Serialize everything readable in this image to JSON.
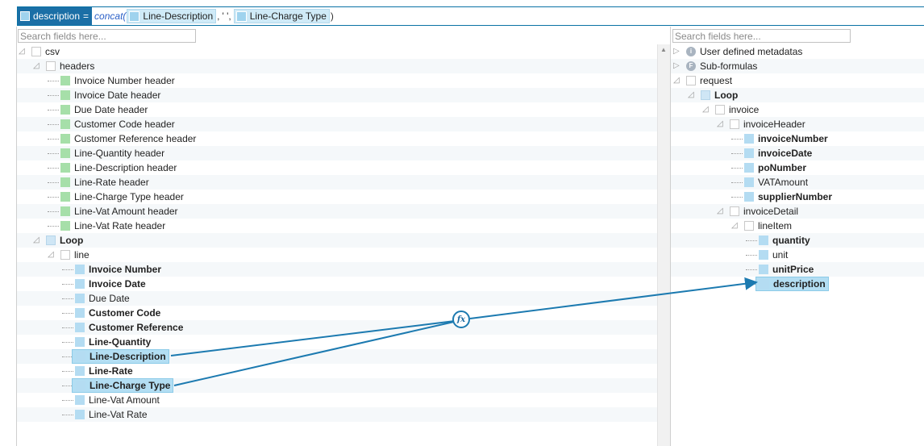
{
  "formula": {
    "target": "description",
    "equals": "=",
    "function": "concat(",
    "arg1": "Line-Description",
    "sep1": ",",
    "arg2_literal": "' '",
    "sep2": ",",
    "arg3": "Line-Charge Type",
    "close": ")"
  },
  "left": {
    "search_placeholder": "Search fields here...",
    "rows": [
      {
        "label": "csv",
        "level": 0,
        "icon": "folder",
        "toggle": "expanded"
      },
      {
        "label": "headers",
        "level": 1,
        "icon": "folder",
        "toggle": "expanded"
      },
      {
        "label": "Invoice Number header",
        "level": 2,
        "icon": "green"
      },
      {
        "label": "Invoice Date header",
        "level": 2,
        "icon": "green"
      },
      {
        "label": "Due Date header",
        "level": 2,
        "icon": "green"
      },
      {
        "label": "Customer Code header",
        "level": 2,
        "icon": "green"
      },
      {
        "label": "Customer Reference header",
        "level": 2,
        "icon": "green"
      },
      {
        "label": "Line-Quantity header",
        "level": 2,
        "icon": "green"
      },
      {
        "label": "Line-Description header",
        "level": 2,
        "icon": "green"
      },
      {
        "label": "Line-Rate header",
        "level": 2,
        "icon": "green"
      },
      {
        "label": "Line-Charge Type header",
        "level": 2,
        "icon": "green"
      },
      {
        "label": "Line-Vat Amount header",
        "level": 2,
        "icon": "green"
      },
      {
        "label": "Line-Vat Rate header",
        "level": 2,
        "icon": "green"
      },
      {
        "label": "Loop",
        "level": 1,
        "icon": "loop",
        "toggle": "expanded",
        "bold": true
      },
      {
        "label": "line",
        "level": 2,
        "icon": "folder",
        "toggle": "expanded"
      },
      {
        "label": "Invoice Number",
        "level": 3,
        "icon": "blue",
        "bold": true
      },
      {
        "label": "Invoice Date",
        "level": 3,
        "icon": "blue",
        "bold": true
      },
      {
        "label": "Due Date",
        "level": 3,
        "icon": "blue"
      },
      {
        "label": "Customer Code",
        "level": 3,
        "icon": "blue",
        "bold": true
      },
      {
        "label": "Customer Reference",
        "level": 3,
        "icon": "blue",
        "bold": true
      },
      {
        "label": "Line-Quantity",
        "level": 3,
        "icon": "blue",
        "bold": true
      },
      {
        "label": "Line-Description",
        "level": 3,
        "icon": "blue",
        "bold": true,
        "selected": true
      },
      {
        "label": "Line-Rate",
        "level": 3,
        "icon": "blue",
        "bold": true
      },
      {
        "label": "Line-Charge Type",
        "level": 3,
        "icon": "blue",
        "bold": true,
        "selected": true
      },
      {
        "label": "Line-Vat Amount",
        "level": 3,
        "icon": "blue"
      },
      {
        "label": "Line-Vat Rate",
        "level": 3,
        "icon": "blue"
      }
    ]
  },
  "right": {
    "search_placeholder": "Search fields here...",
    "rows": [
      {
        "label": "User defined metadatas",
        "level": 0,
        "icon": "info",
        "toggle": "collapsed",
        "glyph": "i"
      },
      {
        "label": "Sub-formulas",
        "level": 0,
        "icon": "info",
        "toggle": "collapsed",
        "glyph": "F"
      },
      {
        "label": "request",
        "level": 0,
        "icon": "folder",
        "toggle": "expanded"
      },
      {
        "label": "Loop",
        "level": 1,
        "icon": "loop",
        "toggle": "expanded",
        "bold": true
      },
      {
        "label": "invoice",
        "level": 2,
        "icon": "folder",
        "toggle": "expanded"
      },
      {
        "label": "invoiceHeader",
        "level": 3,
        "icon": "folder",
        "toggle": "expanded"
      },
      {
        "label": "invoiceNumber",
        "level": 4,
        "icon": "blue",
        "bold": true
      },
      {
        "label": "invoiceDate",
        "level": 4,
        "icon": "blue",
        "bold": true
      },
      {
        "label": "poNumber",
        "level": 4,
        "icon": "blue",
        "bold": true
      },
      {
        "label": "VATAmount",
        "level": 4,
        "icon": "blue"
      },
      {
        "label": "supplierNumber",
        "level": 4,
        "icon": "blue",
        "bold": true
      },
      {
        "label": "invoiceDetail",
        "level": 3,
        "icon": "folder",
        "toggle": "expanded"
      },
      {
        "label": "lineItem",
        "level": 4,
        "icon": "folder",
        "toggle": "expanded"
      },
      {
        "label": "quantity",
        "level": 5,
        "icon": "blue",
        "bold": true
      },
      {
        "label": "unit",
        "level": 5,
        "icon": "blue"
      },
      {
        "label": "unitPrice",
        "level": 5,
        "icon": "blue",
        "bold": true
      },
      {
        "label": "description",
        "level": 5,
        "icon": "blue",
        "bold": true,
        "selected": true
      }
    ]
  },
  "function_node": {
    "label": "fx"
  },
  "colors": {
    "link": "#1c7ab0",
    "selected": "#b3def3",
    "target_bg": "#1b6fa6"
  }
}
